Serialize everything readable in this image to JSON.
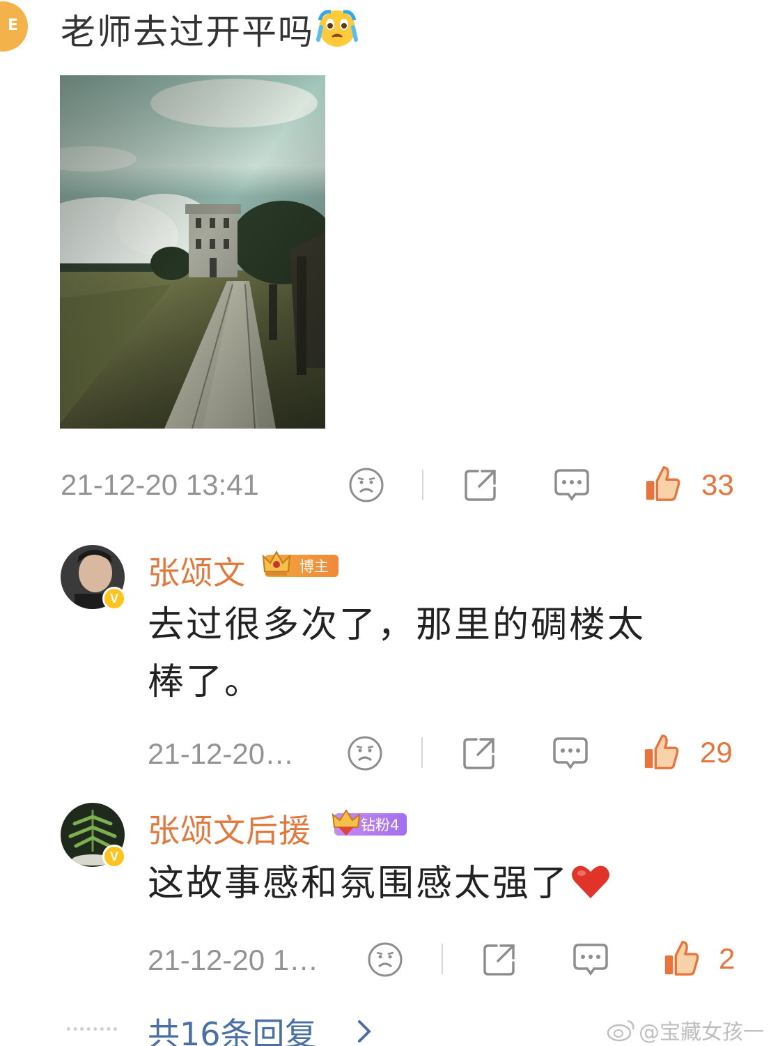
{
  "top_comment": {
    "avatar_initial": "E",
    "text": "老师去过开平吗",
    "emoji": "crying-face-emoji",
    "timestamp": "21-12-20 13:41",
    "like_count": "33"
  },
  "replies": [
    {
      "name": "张颂文",
      "badge": "博主",
      "text_line1": "去过很多次了，那里的碉楼太",
      "text_line2": "棒了。",
      "timestamp": "21-12-20…",
      "like_count": "29",
      "verified_mark": "V"
    },
    {
      "name": "张颂文后援",
      "badge": "钻粉4",
      "text_line1": "这故事感和氛围感太强了",
      "timestamp": "21-12-20 1…",
      "like_count": "2",
      "verified_mark": "V"
    }
  ],
  "more_replies": "共16条回复",
  "watermark": "@宝藏女孩一",
  "colors": {
    "name_orange": "#e3783c",
    "like_orange": "#e8743b",
    "link_blue": "#4a6fa5",
    "meta_gray": "#939393"
  }
}
